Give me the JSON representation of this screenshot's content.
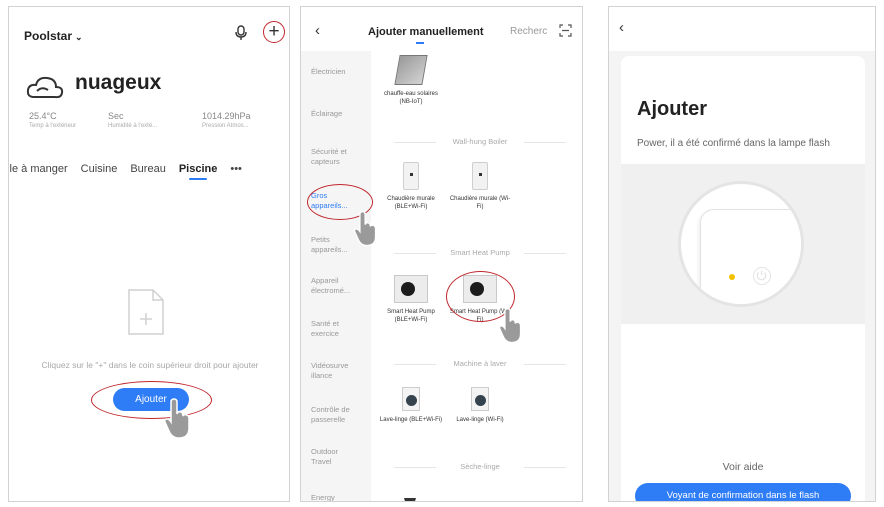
{
  "screen1": {
    "home_name": "Poolstar",
    "weather": "nuageux",
    "stats": [
      {
        "value": "25.4°C",
        "label": "Temp à l'extérieur"
      },
      {
        "value": "Sec",
        "label": "Humidité à l'exté..."
      },
      {
        "value": "1014.29hPa",
        "label": "Pression Atmos..."
      }
    ],
    "rooms": [
      "alle à manger",
      "Cuisine",
      "Bureau",
      "Piscine",
      "•••"
    ],
    "active_room": "Piscine",
    "empty_text": "Cliquez sur le \"+\" dans le coin supérieur droit pour ajouter",
    "add_button": "Ajouter"
  },
  "screen2": {
    "title": "Ajouter manuellement",
    "search": "Recherc",
    "categories": [
      "Électricien",
      "Éclairage",
      "Sécurité et capteurs",
      "Gros appareils...",
      "Petits appareils...",
      "Appareil électromé...",
      "Santé et exercice",
      "Vidéosurveillance",
      "Contrôle de passerelle",
      "Outdoor Travel",
      "Energy"
    ],
    "active_category": "Gros appareils...",
    "top_item": "chauffe-eau solaires (NB-IoT)",
    "sections": [
      {
        "title": "Wall-hung Boiler",
        "items": [
          "Chaudière murale (BLE+Wi-Fi)",
          "Chaudière murale (Wi-Fi)"
        ]
      },
      {
        "title": "Smart Heat Pump",
        "items": [
          "Smart Heat Pump (BLE+Wi-Fi)",
          "Smart Heat Pump (Wi-Fi)"
        ]
      },
      {
        "title": "Machine à laver",
        "items": [
          "Lave-linge (BLE+Wi-Fi)",
          "Lave-linge (Wi-Fi)"
        ]
      },
      {
        "title": "Sèche-linge",
        "items": []
      }
    ]
  },
  "screen3": {
    "title": "Ajouter",
    "description": "Power, il a été confirmé dans la lampe flash",
    "help": "Voir aide",
    "confirm_button": "Voyant de confirmation dans le flash"
  },
  "colors": {
    "accent": "#2e7cf6",
    "annotation": "#c0272d",
    "indicator": "#f2c200"
  }
}
